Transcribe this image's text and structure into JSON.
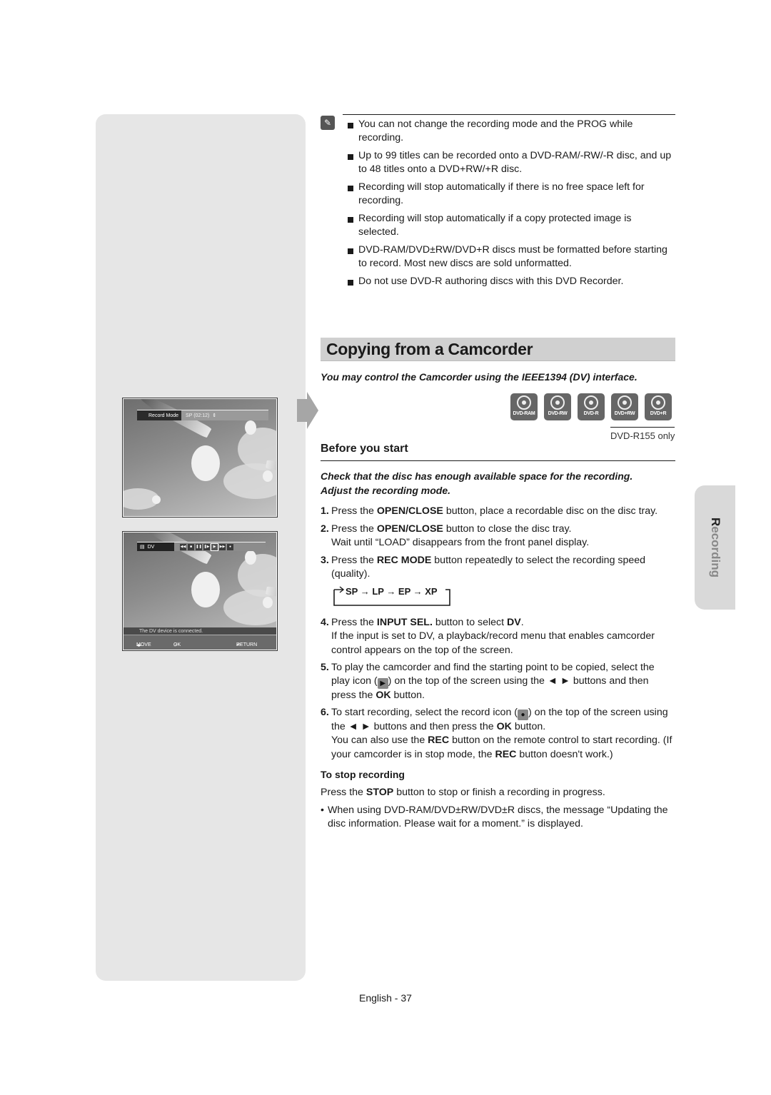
{
  "notes": [
    "You can not change the recording mode and the PROG while recording.",
    "Up to 99 titles can be recorded onto a DVD-RAM/-RW/-R disc, and up to 48 titles onto a DVD+RW/+R disc.",
    "Recording will stop automatically if there is no free space left for recording.",
    "Recording will stop automatically if a copy protected image is selected.",
    "DVD-RAM/DVD±RW/DVD+R discs must be formatted before starting to record. Most new discs are sold unformatted.",
    "Do not use DVD-R authoring discs with this DVD Recorder."
  ],
  "section": {
    "title": "Copying from a Camcorder",
    "subtitle": "You may control the Camcorder using the IEEE1394 (DV) interface."
  },
  "discs": [
    "DVD-RAM",
    "DVD-RW",
    "DVD-R",
    "DVD+RW",
    "DVD+R"
  ],
  "disc_note": "DVD-R155 only",
  "screens": {
    "record_mode": {
      "label": "Record Mode",
      "value": "SP (02:12)"
    },
    "dv": {
      "label": "DV",
      "controls": [
        "◀◀",
        "■",
        "❚❚",
        "❚▶",
        "▶",
        "▶▶",
        "●"
      ],
      "status": "The DV device is connected.",
      "move": "MOVE",
      "ok": "OK",
      "return": "RETURN"
    }
  },
  "before": {
    "heading": "Before you start",
    "lead_1": "Check that the disc has enough available space for the recording.",
    "lead_2": "Adjust the recording mode."
  },
  "steps": {
    "s1": {
      "num": "1.",
      "pre": "Press the ",
      "b1": "OPEN/CLOSE",
      "post": " button, place a recordable disc on the disc tray."
    },
    "s2": {
      "num": "2.",
      "pre": "Press the ",
      "b1": "OPEN/CLOSE",
      "post": " button to close the disc tray.",
      "line2": "Wait until “LOAD” disappears from the front panel display."
    },
    "s3": {
      "num": "3.",
      "pre": "Press the ",
      "b1": "REC MODE",
      "post": " button repeatedly to select the recording speed",
      "line2": "(quality)."
    },
    "cycle": "SP → LP → EP → XP",
    "s4": {
      "num": "4.",
      "pre": "Press the ",
      "b1": "INPUT SEL.",
      "mid": " button to select ",
      "b2": "DV",
      "post": ".",
      "line2": "If the input is set to DV, a playback/record menu that enables camcorder",
      "line3": "control appears on the top of the screen."
    },
    "s5": {
      "num": "5.",
      "line1": "To play the camcorder and find the starting point to be copied, select the",
      "l2a": "play icon (",
      "l2b": ") on the top of the screen using the ◄ ► buttons and then",
      "l3a": "press the ",
      "b1": "OK",
      "l3b": " button."
    },
    "s6": {
      "num": "6.",
      "l1a": "To start recording, select the record icon (",
      "l1b": ") on the top of the screen using",
      "l2a": "the ◄ ► buttons and then press the ",
      "b1": "OK",
      "l2b": " button.",
      "l3a": "You can also use the ",
      "b2": "REC",
      "l3b": " button on the remote control to start recording. (If",
      "l4a": "your camcorder is in stop mode, the ",
      "b3": "REC",
      "l4b": " button doesn't work.)"
    }
  },
  "stop": {
    "heading": "To stop recording",
    "pre": "Press the ",
    "b1": "STOP",
    "post": " button to stop or finish a recording in progress.",
    "bullet": "When using DVD-RAM/DVD±RW/DVD±R discs, the message “Updating the disc information. Please wait for a moment.” is displayed."
  },
  "side_tab": {
    "first": "R",
    "rest": "ecording"
  },
  "footer": "English - 37"
}
